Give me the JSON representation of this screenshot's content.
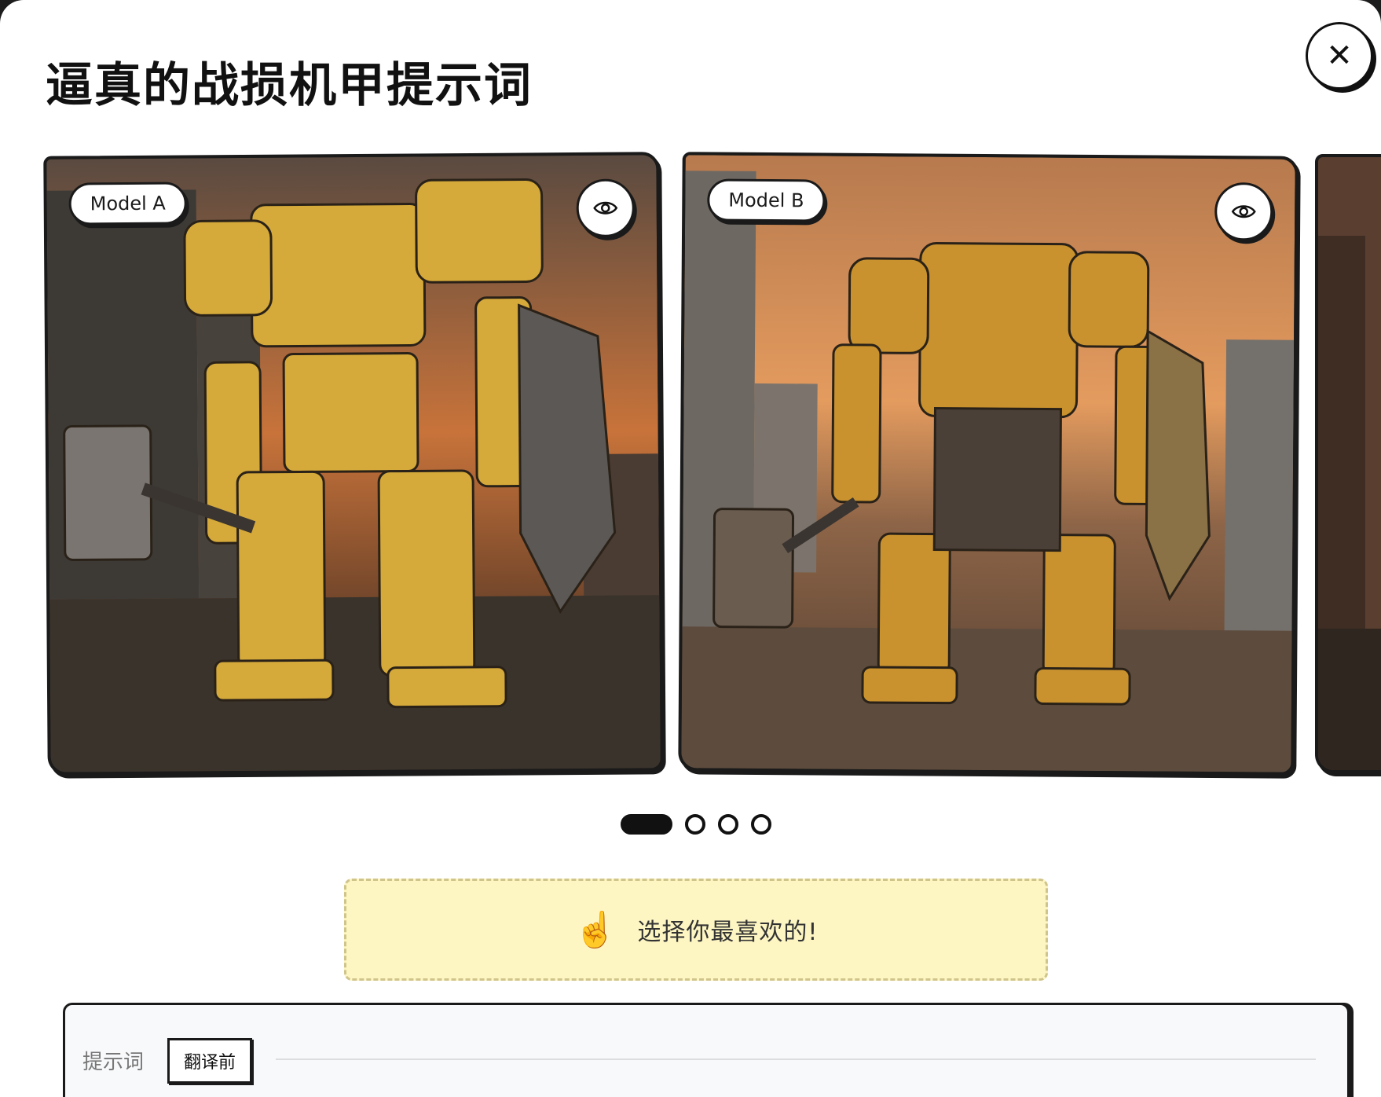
{
  "modal": {
    "title": "逼真的战损机甲提示词",
    "close_icon": "close-icon"
  },
  "carousel": {
    "cards": [
      {
        "label": "Model A",
        "icon": "eye-icon"
      },
      {
        "label": "Model B",
        "icon": "eye-icon"
      },
      {
        "label": "",
        "icon": "eye-icon"
      }
    ],
    "page_count": 4,
    "active_page": 1
  },
  "hint": {
    "emoji": "☝️",
    "text": "选择你最喜欢的!"
  },
  "prompt": {
    "label": "提示词",
    "translate_button": "翻译前"
  },
  "colors": {
    "hint_bg": "#fdf6c3",
    "border": "#1a1a1a"
  }
}
